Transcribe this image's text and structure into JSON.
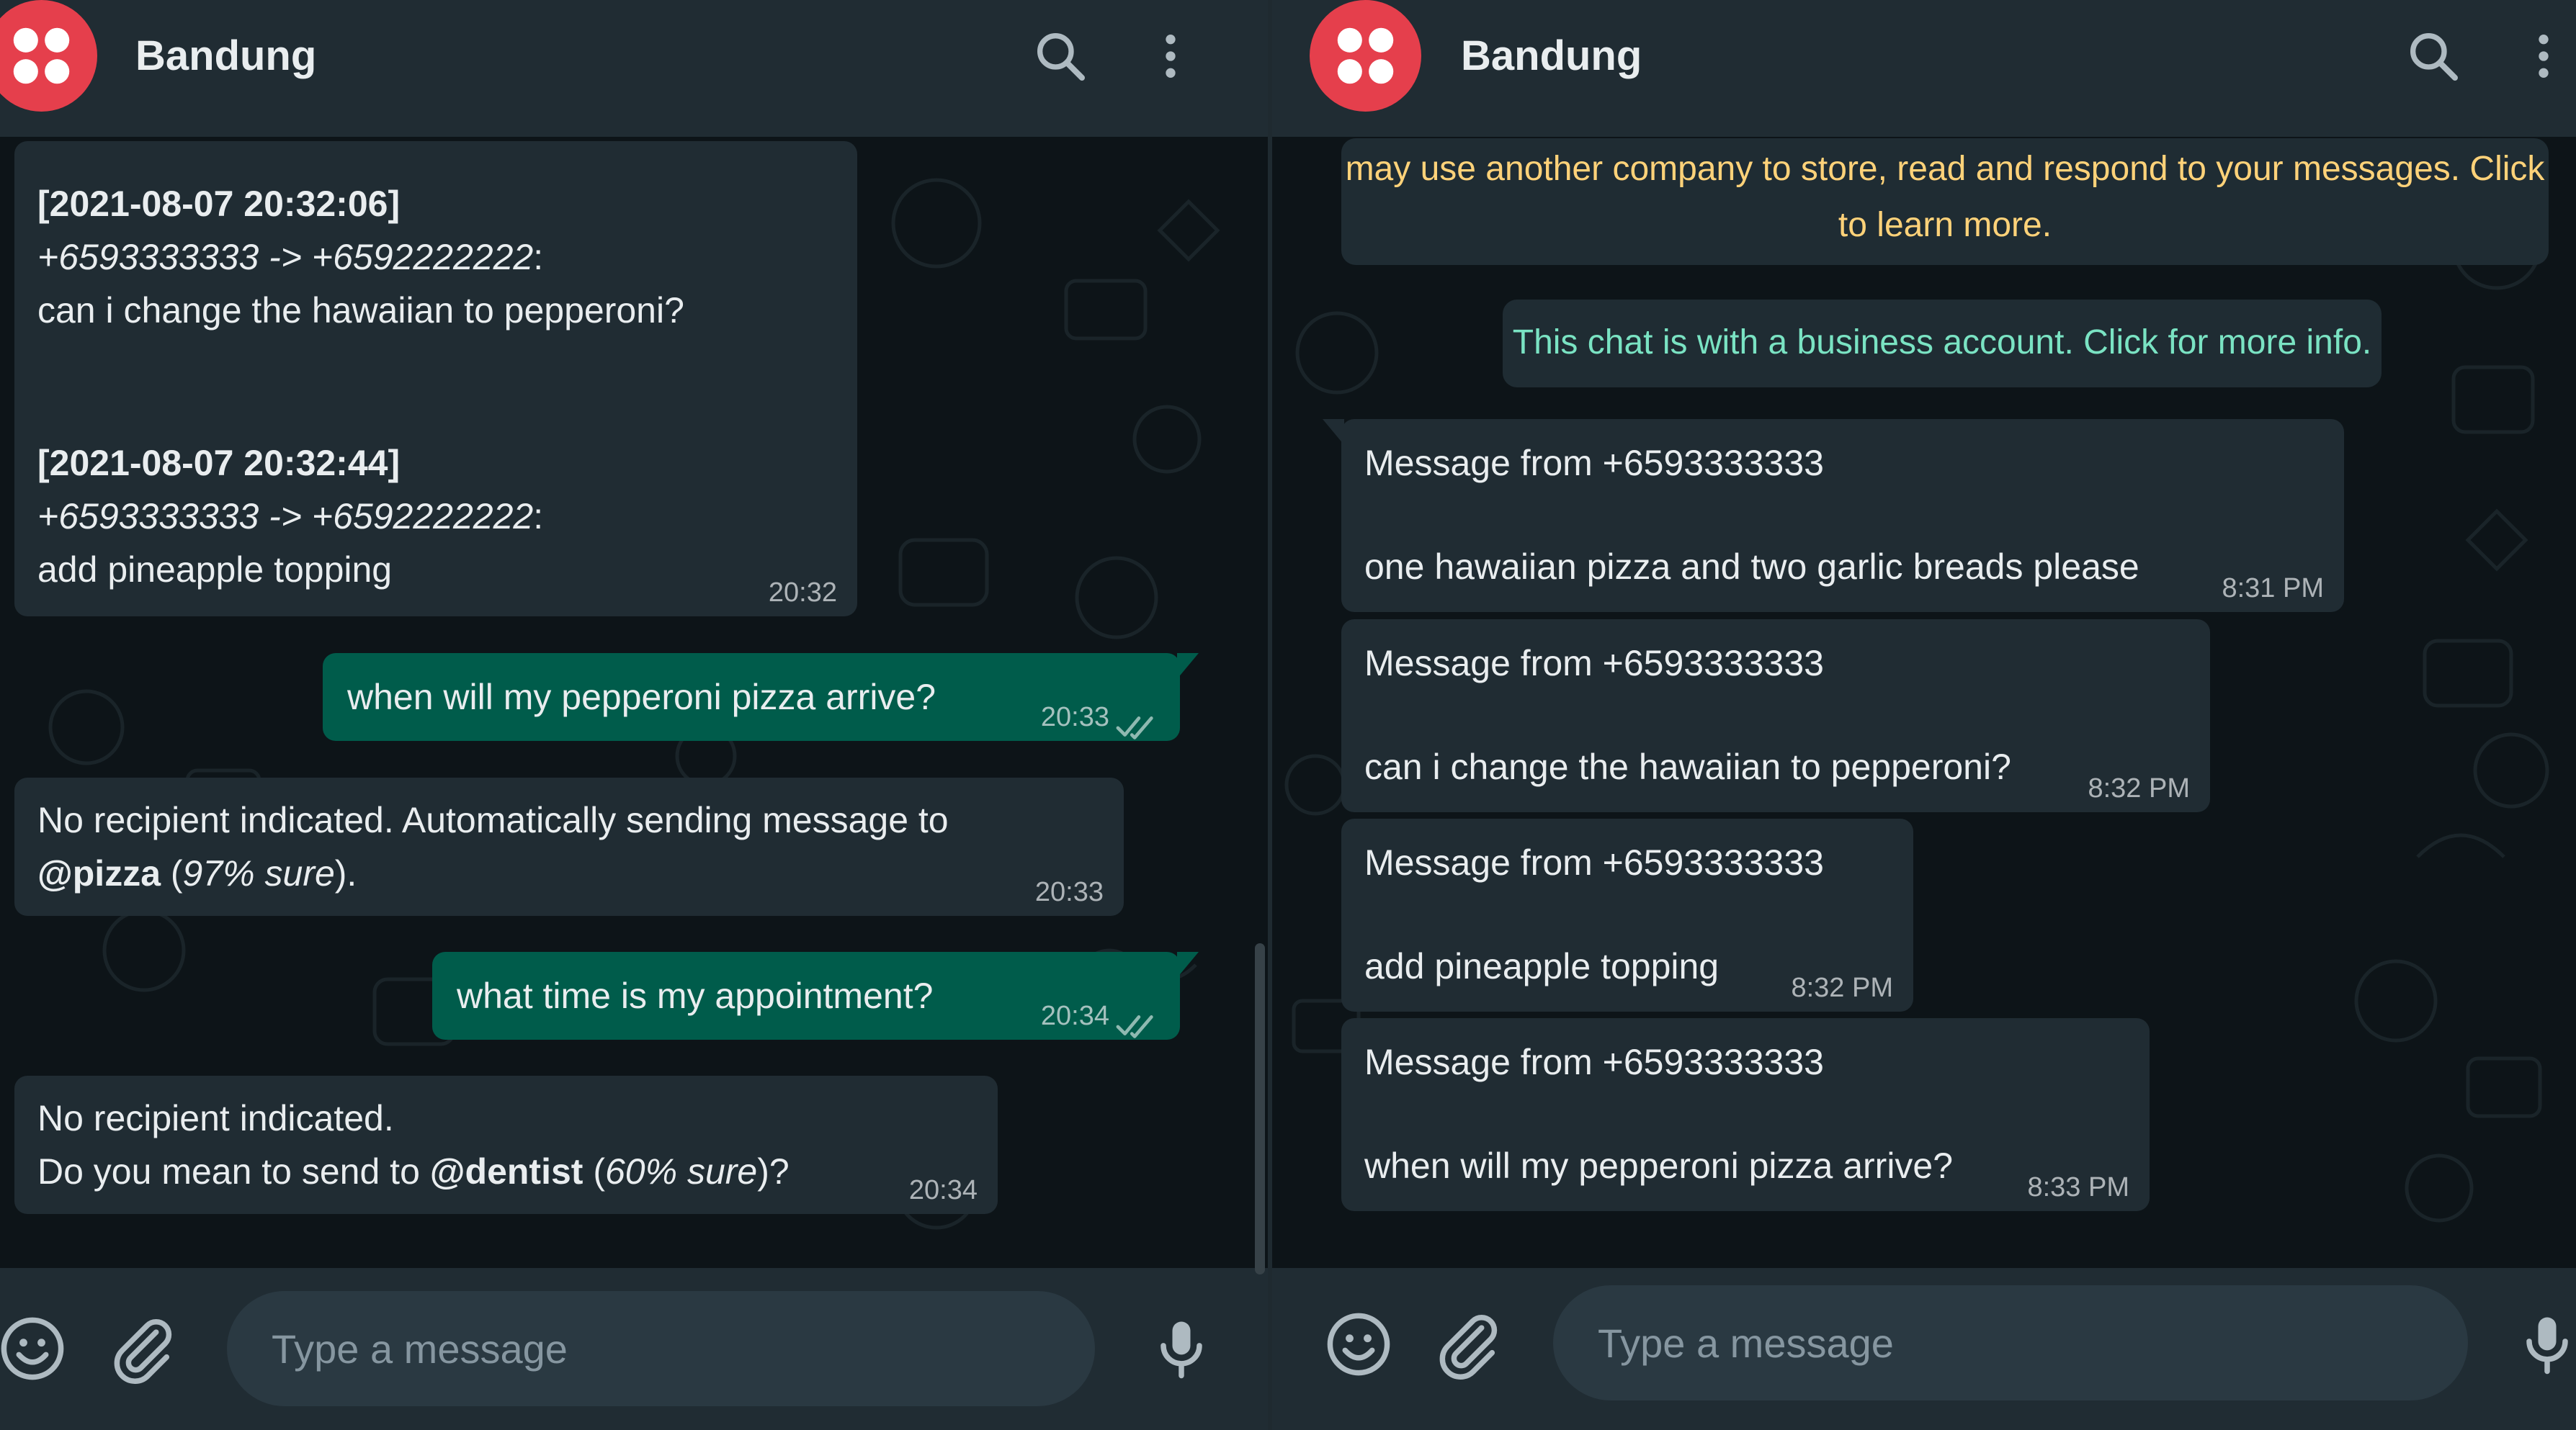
{
  "left": {
    "header": {
      "title": "Bandung"
    },
    "messages": [
      {
        "type": "incoming",
        "blocks": [
          {
            "stamp": "[2021-08-07 20:32:06]",
            "route": "+6593333333 -> +6592222222",
            "colon": ":",
            "text": "can i change the hawaiian to pepperoni?"
          },
          {
            "stamp": "[2021-08-07 20:32:44]",
            "route": "+6593333333 -> +6592222222",
            "colon": ":",
            "text": "add pineapple topping"
          }
        ],
        "time": "20:32"
      },
      {
        "type": "outgoing",
        "text": "when will my pepperoni pizza arrive?",
        "time": "20:33",
        "status": "read"
      },
      {
        "type": "incoming",
        "line1": "No recipient indicated. Automatically sending message to",
        "mention": "@pizza",
        "open": " (",
        "confidence": "97% sure",
        "close": ").",
        "time": "20:33"
      },
      {
        "type": "outgoing",
        "text": "what time is my appointment?",
        "time": "20:34",
        "status": "read"
      },
      {
        "type": "incoming",
        "line1": "No recipient indicated.",
        "prefix": "Do you mean to send to ",
        "mention": "@dentist",
        "open": " (",
        "confidence": "60% sure",
        "close": ")?",
        "time": "20:34"
      }
    ],
    "composer": {
      "placeholder": "Type a message"
    }
  },
  "right": {
    "header": {
      "title": "Bandung"
    },
    "encryption_notice": {
      "line1": "may use another company to store, read and respond to your messages. Click",
      "line2": "to learn more."
    },
    "business_notice": "This chat is with a business account. Click for more info.",
    "messages": [
      {
        "type": "incoming",
        "title": "Message from +6593333333",
        "text": "one hawaiian pizza and two garlic breads please",
        "time": "8:31 PM"
      },
      {
        "type": "incoming",
        "title": "Message from +6593333333",
        "text": "can i change the hawaiian to pepperoni?",
        "time": "8:32 PM"
      },
      {
        "type": "incoming",
        "title": "Message from +6593333333",
        "text": "add pineapple topping",
        "time": "8:32 PM"
      },
      {
        "type": "incoming",
        "title": "Message from +6593333333",
        "text": "when will my pepperoni pizza arrive?",
        "time": "8:33 PM"
      }
    ],
    "composer": {
      "placeholder": "Type a message"
    }
  },
  "colors": {
    "header_bg": "#202c33",
    "chat_bg": "#0d1418",
    "incoming_bubble": "#202c33",
    "outgoing_bubble": "#005c4b",
    "avatar_red": "#e53f4c",
    "notice_yellow": "#ffd279",
    "notice_green": "#7ae3c3",
    "read_tick": "#8fb9b1"
  },
  "icons": [
    "app-logo-icon",
    "search-icon",
    "menu-dots-icon",
    "emoji-icon",
    "attach-icon",
    "microphone-icon",
    "double-check-icon"
  ]
}
